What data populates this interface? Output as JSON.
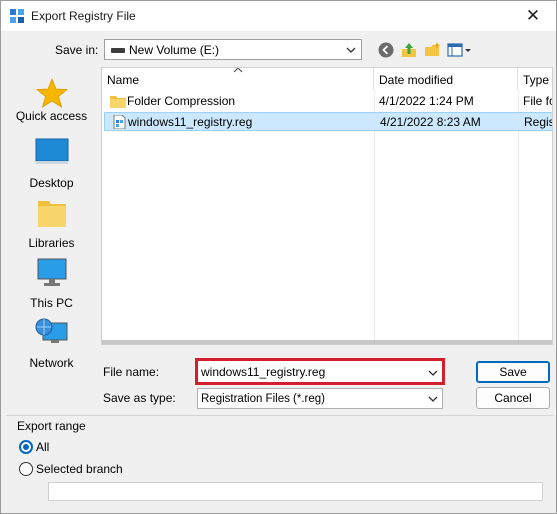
{
  "window": {
    "title": "Export Registry File",
    "close_glyph": "✕",
    "icon": "registry-editor-icon"
  },
  "toolbar": {
    "save_in_label": "Save in:",
    "save_in_value": "New Volume (E:)",
    "back_icon": "back-arrow-icon",
    "up_icon": "up-folder-icon",
    "new_folder_icon": "new-folder-icon",
    "view_icon": "view-menu-icon"
  },
  "places": [
    {
      "label": "Quick access",
      "icon": "star-icon"
    },
    {
      "label": "Desktop",
      "icon": "desktop-icon"
    },
    {
      "label": "Libraries",
      "icon": "libraries-icon"
    },
    {
      "label": "This PC",
      "icon": "computer-icon"
    },
    {
      "label": "Network",
      "icon": "network-icon"
    }
  ],
  "file_list": {
    "columns": [
      "Name",
      "Date modified",
      "Type"
    ],
    "rows": [
      {
        "name": "Folder Compression",
        "date": "4/1/2022 1:24 PM",
        "type": "File fo",
        "icon": "folder-icon",
        "selected": false
      },
      {
        "name": "windows11_registry.reg",
        "date": "4/21/2022 8:23 AM",
        "type": "Regis",
        "icon": "reg-file-icon",
        "selected": true
      }
    ]
  },
  "fields": {
    "file_name_label": "File name:",
    "file_name_value": "windows11_registry.reg",
    "save_as_type_label": "Save as type:",
    "save_as_type_value": "Registration Files (*.reg)"
  },
  "buttons": {
    "save": "Save",
    "cancel": "Cancel"
  },
  "export_range": {
    "title": "Export range",
    "all_label": "All",
    "branch_label": "Selected branch",
    "branch_value": "",
    "selected": "all"
  },
  "colors": {
    "accent": "#0067c0",
    "highlight_border": "#d21f2b",
    "selection": "#cce8ff"
  }
}
